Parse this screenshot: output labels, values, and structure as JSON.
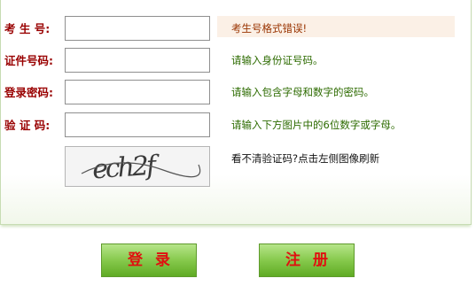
{
  "form": {
    "exam_no": {
      "label": "考 生 号:",
      "value": "",
      "hint": "考生号格式错误!"
    },
    "id_no": {
      "label": "证件号码:",
      "value": "",
      "hint": "请输入身份证号码。"
    },
    "password": {
      "label": "登录密码:",
      "value": "",
      "hint": "请输入包含字母和数字的密码。"
    },
    "captcha": {
      "label": "验 证 码:",
      "value": "",
      "hint": "请输入下方图片中的6位数字或字母。",
      "image_text": "ech2f",
      "refresh_text": "看不清验证码?点击左侧图像刷新"
    }
  },
  "buttons": {
    "login_label": "登录",
    "register_label": "注册"
  },
  "colors": {
    "label_color": "#990000",
    "hint_color": "#2d6b00",
    "error_color": "#993300",
    "button_text": "#e01010",
    "button_green": "#86c94c"
  }
}
